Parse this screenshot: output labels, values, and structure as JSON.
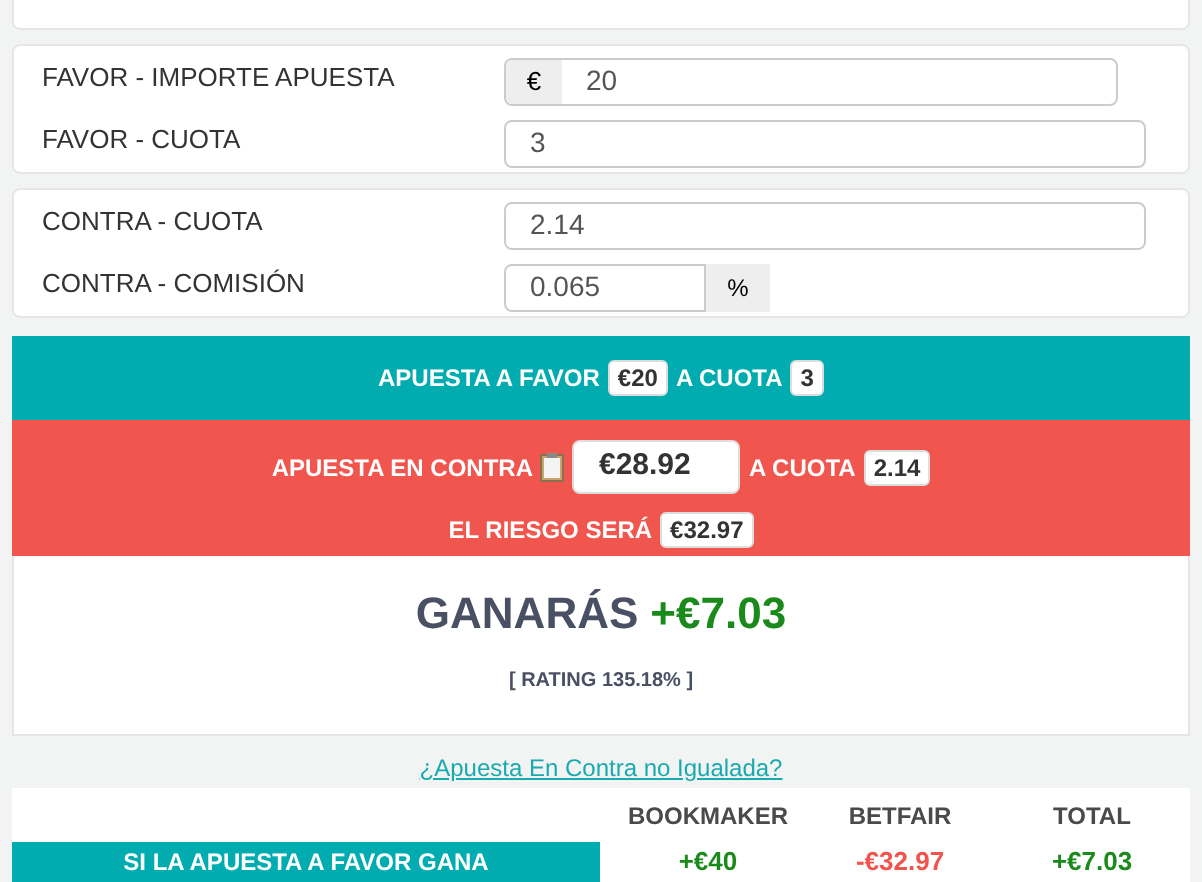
{
  "favor_card": {
    "fields": [
      {
        "label": "FAVOR - IMPORTE APUESTA",
        "prefix": "€",
        "value": "20"
      },
      {
        "label": "FAVOR - CUOTA",
        "value": "3"
      }
    ]
  },
  "contra_card": {
    "fields": [
      {
        "label": "CONTRA - CUOTA",
        "value": "2.14"
      },
      {
        "label": "CONTRA - COMISIÓN",
        "value": "0.065",
        "suffix": "%"
      }
    ]
  },
  "favor_band": {
    "text": "APUESTA A FAVOR",
    "stake": "€20",
    "odds_text": "A CUOTA",
    "odds": "3"
  },
  "contra_band": {
    "text": "APUESTA EN CONTRA",
    "stake": "€28.92",
    "odds_text": "A CUOTA",
    "odds": "2.14",
    "risk_text": "EL RIESGO SERÁ",
    "risk": "€32.97"
  },
  "result": {
    "label": "GANARÁS",
    "value": "+€7.03",
    "rating": "[ RATING 135.18% ]"
  },
  "link": "¿Apuesta En Contra no Igualada?",
  "table": {
    "columns": [
      "BOOKMAKER",
      "BETFAIR",
      "TOTAL"
    ],
    "rows": [
      {
        "label": "SI LA APUESTA A FAVOR GANA",
        "cells": [
          {
            "text": "+€40",
            "kind": "positive"
          },
          {
            "text": "-€32.97",
            "kind": "negative"
          },
          {
            "text": "+€7.03",
            "kind": "positive"
          }
        ]
      }
    ]
  }
}
